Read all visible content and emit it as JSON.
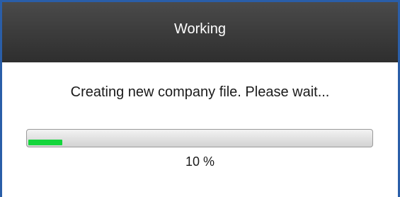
{
  "window": {
    "title": "Working"
  },
  "message": "Creating new company file. Please wait...",
  "progress": {
    "percent": 10,
    "label": "10 %",
    "fill_color": "#14d63c"
  }
}
